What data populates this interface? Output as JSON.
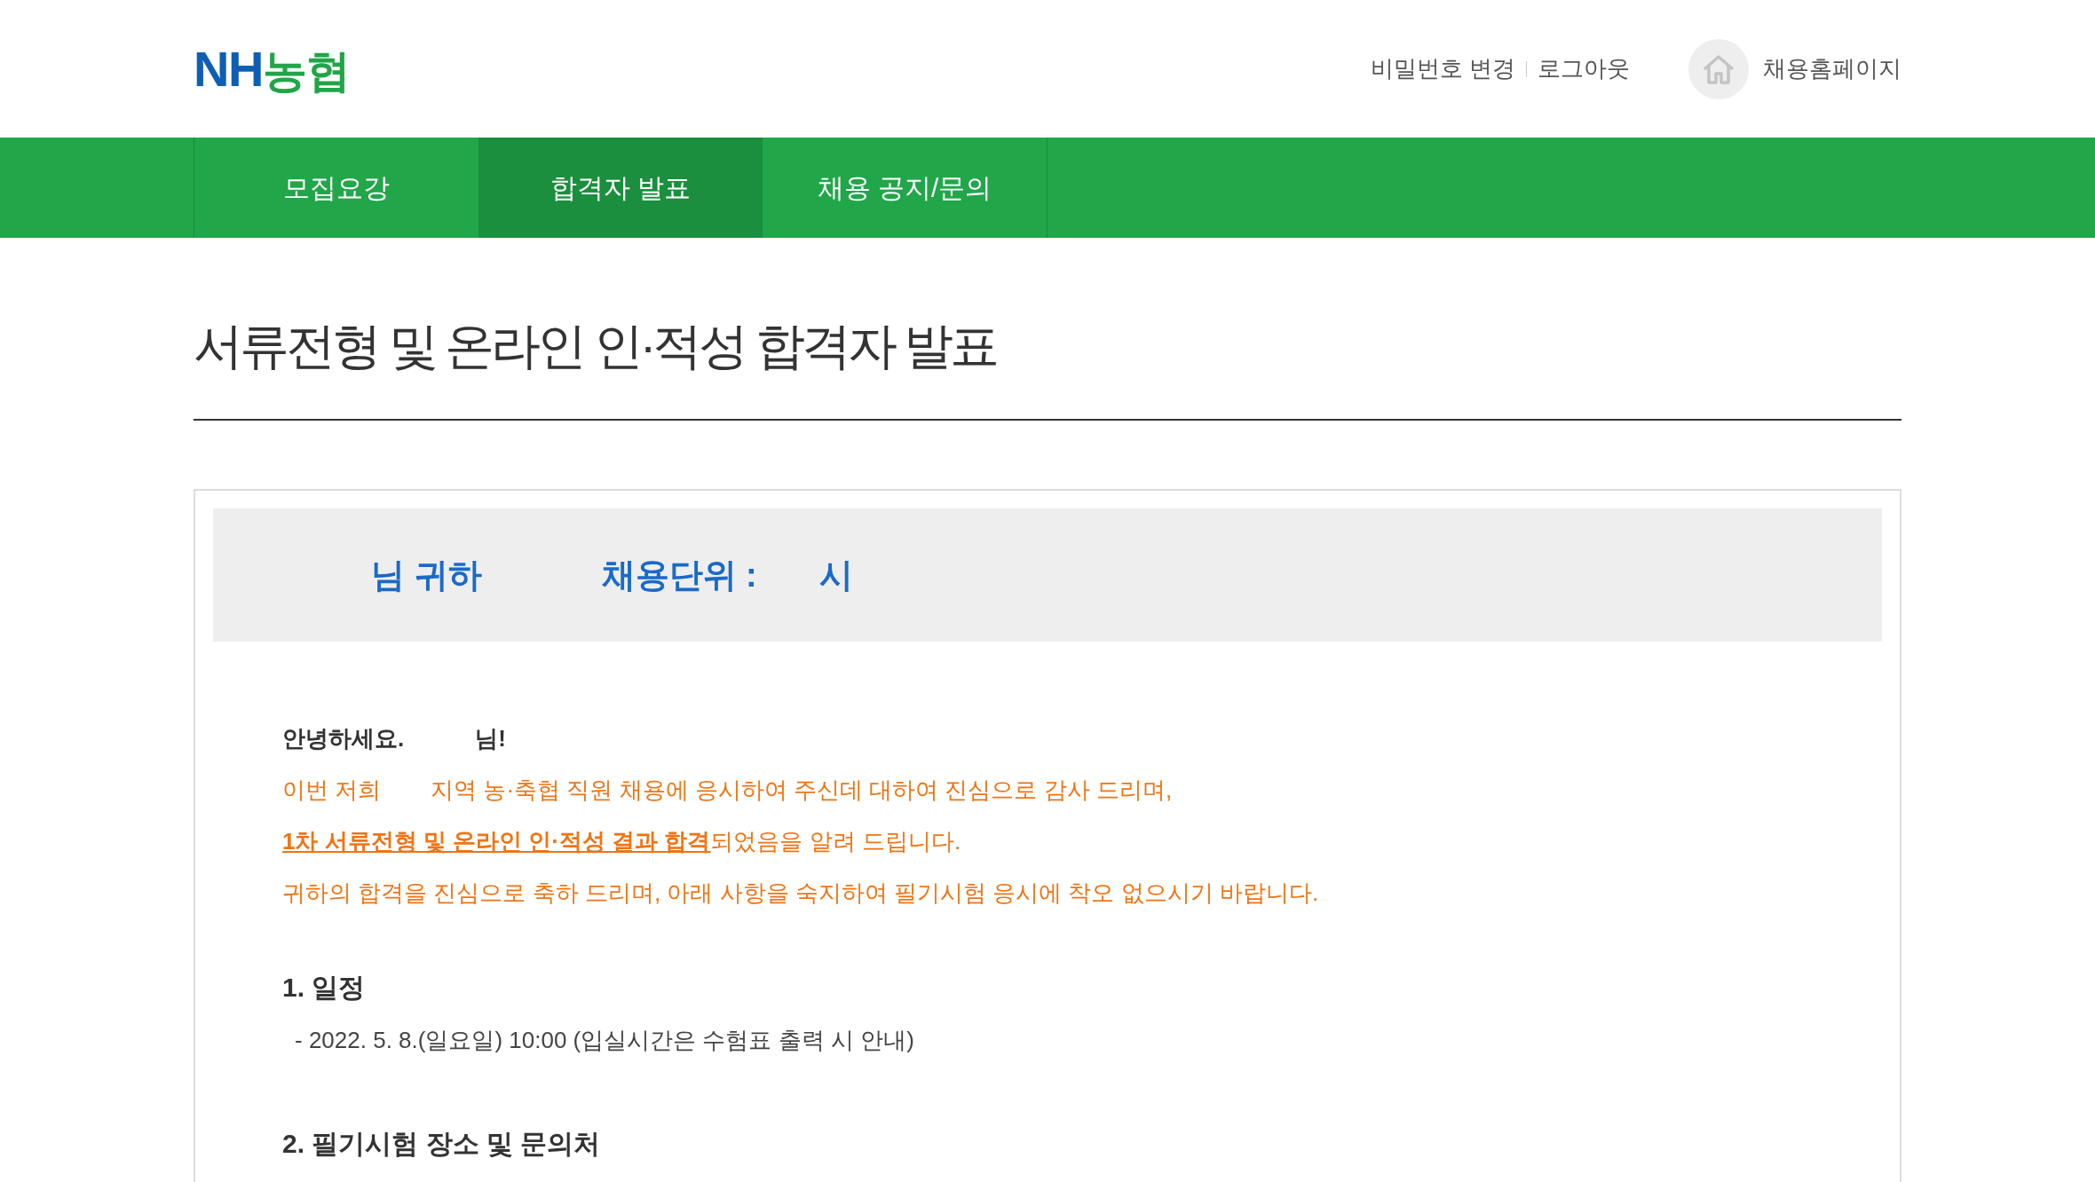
{
  "logo": {
    "latin": "NH",
    "hangul": "농협"
  },
  "header_links": [
    {
      "label": "비밀번호 변경"
    },
    {
      "label": "로그아웃"
    }
  ],
  "home_link": {
    "label": "채용홈페이지"
  },
  "nav": [
    {
      "label": "모집요강",
      "selected": false
    },
    {
      "label": "합격자 발표",
      "selected": true
    },
    {
      "label": "채용 공지/문의",
      "selected": false
    }
  ],
  "page_title": "서류전형 및 온라인 인·적성 합격자 발표",
  "info_box": {
    "recipient": "님 귀하",
    "unit_label": "채용단위 :",
    "unit_value": "시"
  },
  "greeting": {
    "hello": "안녕하세요.",
    "name_suffix": "님!"
  },
  "message_lines": [
    {
      "parts": [
        "이번 저희",
        "지역 농·축협 직원 채용에 응시하여 주신데 대하여 진심으로 감사 드리며,"
      ]
    },
    {
      "parts": [
        "**1차 서류전형 및 온라인 인·적성 결과 합격**되었음을 알려 드립니다."
      ]
    },
    {
      "parts": [
        "귀하의 합격을 진심으로 축하 드리며, 아래 사항을 숙지하여 필기시험 응시에 착오 없으시기 바랍니다."
      ]
    }
  ],
  "sections": [
    {
      "heading": "1. 일정",
      "items": [
        "- 2022. 5. 8.(일요일) 10:00 (입실시간은 수험표 출력 시 안내)"
      ]
    },
    {
      "heading": "2. 필기시험 장소 및 문의처"
    }
  ]
}
